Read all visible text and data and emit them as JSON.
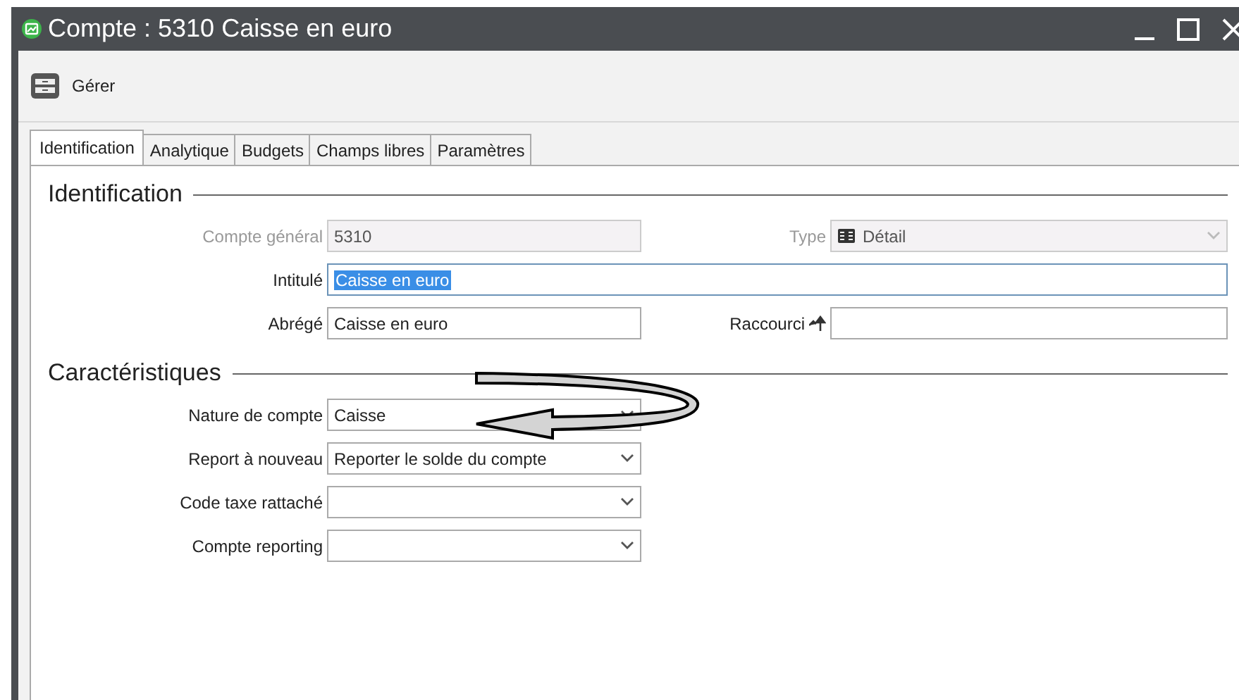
{
  "window": {
    "title": "Compte : 5310 Caisse en euro"
  },
  "toolbar": [
    {
      "label": "Gérer"
    }
  ],
  "tabs": [
    {
      "label": "Identification",
      "selected": true
    },
    {
      "label": "Analytique",
      "selected": false
    },
    {
      "label": "Budgets",
      "selected": false
    },
    {
      "label": "Champs libres",
      "selected": false
    },
    {
      "label": "Paramètres",
      "selected": false
    }
  ],
  "sections": [
    {
      "title": "Identification",
      "rows": [
        [
          {
            "kind": "text",
            "label": "Compte général",
            "value": "5310",
            "disabled": true
          },
          {
            "kind": "select",
            "label": "Type",
            "value": "Détail",
            "disabled": true
          }
        ],
        [
          {
            "kind": "wide",
            "label": "Intitulé",
            "value": "Caisse en euro",
            "disabled": false,
            "text_selected": true
          }
        ],
        [
          {
            "kind": "text",
            "label": "Abrégé",
            "value": "Caisse en euro",
            "disabled": false
          },
          {
            "kind": "shortcut",
            "label": "Raccourci",
            "disabled": false
          }
        ]
      ]
    },
    {
      "title": "Caractéristiques",
      "rows": [
        [
          {
            "kind": "select",
            "label": "Nature de compte",
            "value": "Caisse",
            "disabled": false
          }
        ],
        [
          {
            "kind": "select",
            "label": "Report à nouveau",
            "value": "Reporter le solde du compte",
            "disabled": false
          }
        ],
        [
          {
            "kind": "select",
            "label": "Code taxe rattaché",
            "disabled": false
          }
        ],
        [
          {
            "kind": "select",
            "label": "Compte reporting",
            "disabled": false
          }
        ]
      ]
    }
  ]
}
